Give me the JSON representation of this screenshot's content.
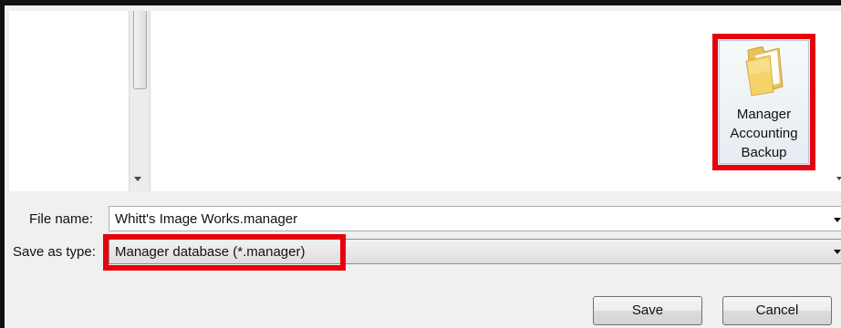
{
  "folder": {
    "icon": "folder-icon",
    "name_lines": [
      "Manager",
      "Accounting",
      "Backup"
    ]
  },
  "form": {
    "file_name_label": "File name:",
    "file_name_value": "Whitt's Image Works.manager",
    "save_as_type_label": "Save as type:",
    "save_as_type_value": "Manager database (*.manager)"
  },
  "buttons": {
    "save": "Save",
    "cancel": "Cancel"
  },
  "colors": {
    "highlight": "#e8000b",
    "folder_yellow": "#f5d36b"
  }
}
